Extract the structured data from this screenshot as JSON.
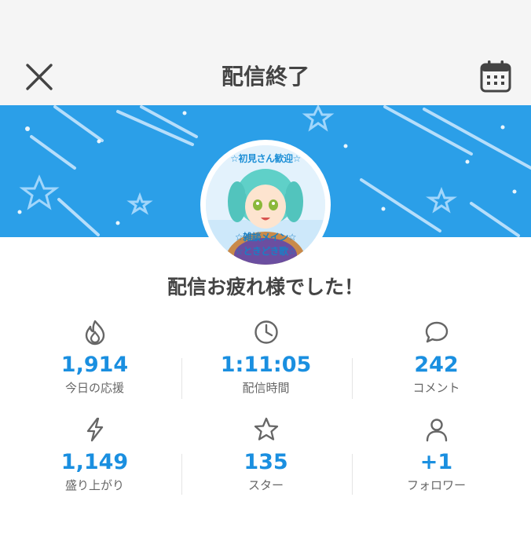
{
  "header": {
    "title": "配信終了",
    "close_icon": "close-icon",
    "calendar_icon": "calendar-icon"
  },
  "avatar": {
    "line1": "☆初見さん歓迎☆",
    "line2": "☆雑談メイン☆",
    "line3": "☆ときどき歌☆"
  },
  "message": "配信お疲れ様でした！",
  "stats": [
    {
      "icon": "flame-icon",
      "value": "1,914",
      "label": "今日の応援"
    },
    {
      "icon": "clock-icon",
      "value": "1:11:05",
      "label": "配信時間"
    },
    {
      "icon": "comment-icon",
      "value": "242",
      "label": "コメント"
    },
    {
      "icon": "lightning-icon",
      "value": "1,149",
      "label": "盛り上がり"
    },
    {
      "icon": "star-icon",
      "value": "135",
      "label": "スター"
    },
    {
      "icon": "person-icon",
      "value": "+1",
      "label": "フォロワー"
    }
  ],
  "colors": {
    "accent": "#1a8fe0",
    "banner": "#2b9fe8",
    "header_bg": "#f5f5f5"
  }
}
